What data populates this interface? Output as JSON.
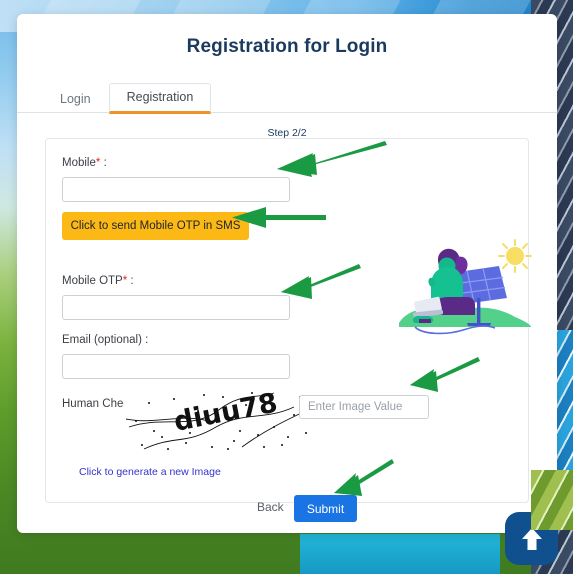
{
  "page": {
    "title": "Registration for Login",
    "step_label": "Step 2/2"
  },
  "tabs": [
    {
      "label": "Login",
      "active": false
    },
    {
      "label": "Registration",
      "active": true
    }
  ],
  "form": {
    "mobile": {
      "label": "Mobile",
      "required_mark": "*",
      "label_suffix": " :",
      "value": "",
      "placeholder": ""
    },
    "otp_button": {
      "label": "Click to send Mobile OTP in SMS",
      "color": "#fcb916"
    },
    "mobile_otp": {
      "label": "Mobile OTP",
      "required_mark": "*",
      "label_suffix": " :",
      "value": "",
      "placeholder": ""
    },
    "email": {
      "label": "Email (optional) :",
      "value": "",
      "placeholder": ""
    },
    "human_check": {
      "label": "Human Check",
      "required_mark": "*",
      "captcha_text": "diuu78",
      "refresh_link": "Click to generate a new Image",
      "input_placeholder": "Enter Image Value",
      "input_value": ""
    },
    "back_button": "Back",
    "submit_button": "Submit"
  },
  "illustration": {
    "name": "person-with-laptop-and-solar-panel"
  },
  "scroll_top_button": {
    "name": "scroll-to-top",
    "glyph": "↑",
    "color": "#10508f"
  },
  "annotations": {
    "arrow_color": "#1a9a42",
    "arrow_count": 5,
    "targets": [
      "mobile-input",
      "otp-send-button",
      "mobile-otp-input",
      "captcha-input",
      "submit-button"
    ]
  },
  "colors": {
    "title": "#1b3a5e",
    "tab_active_underline": "#f0922b",
    "submit": "#1b74e4",
    "link": "#3333cc",
    "required": "#e02424"
  }
}
